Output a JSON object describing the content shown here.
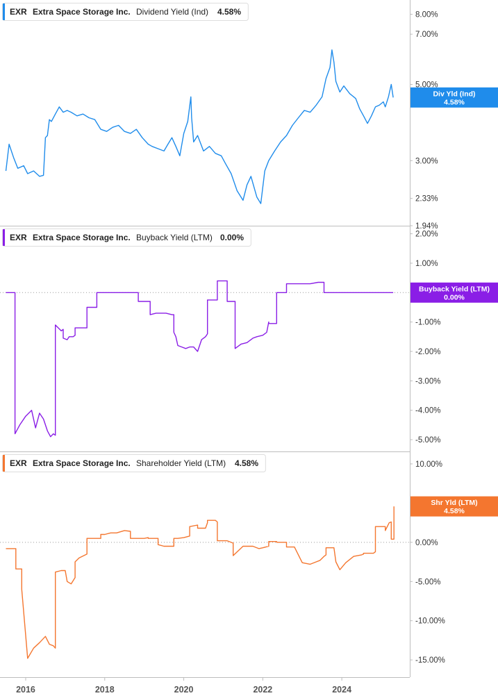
{
  "chart_data": [
    {
      "type": "line",
      "ticker": "EXR",
      "company": "Extra Space Storage Inc.",
      "metric": "Dividend Yield (Ind)",
      "latest": "4.58%",
      "tag_label": "Div Yld (Ind)",
      "tag_value": "4.58%",
      "color": "#1f8ceb",
      "scale": "log",
      "ylim": [
        1.94,
        8.8
      ],
      "y_ticks": [
        "8.00%",
        "7.00%",
        "5.00%",
        "3.00%",
        "2.33%",
        "1.94%"
      ],
      "y_tick_values": [
        8.0,
        7.0,
        5.0,
        3.0,
        2.33,
        1.94
      ],
      "zero_line": false,
      "x": [
        2015.5,
        2015.58,
        2015.7,
        2015.8,
        2015.95,
        2016.05,
        2016.2,
        2016.35,
        2016.45,
        2016.5,
        2016.55,
        2016.6,
        2016.65,
        2016.75,
        2016.85,
        2016.95,
        2017.05,
        2017.15,
        2017.3,
        2017.45,
        2017.6,
        2017.75,
        2017.9,
        2018.05,
        2018.2,
        2018.35,
        2018.5,
        2018.65,
        2018.8,
        2018.95,
        2019.1,
        2019.2,
        2019.35,
        2019.5,
        2019.6,
        2019.7,
        2019.8,
        2019.9,
        2020.0,
        2020.1,
        2020.18,
        2020.2,
        2020.25,
        2020.35,
        2020.5,
        2020.65,
        2020.8,
        2020.95,
        2021.05,
        2021.2,
        2021.35,
        2021.5,
        2021.6,
        2021.7,
        2021.85,
        2021.95,
        2022.05,
        2022.15,
        2022.3,
        2022.45,
        2022.6,
        2022.75,
        2022.9,
        2023.05,
        2023.2,
        2023.35,
        2023.5,
        2023.6,
        2023.7,
        2023.75,
        2023.8,
        2023.85,
        2023.95,
        2024.05,
        2024.2,
        2024.35,
        2024.45,
        2024.55,
        2024.65,
        2024.75,
        2024.85,
        2024.95,
        2025.05,
        2025.1,
        2025.18,
        2025.25,
        2025.3
      ],
      "values": [
        2.8,
        3.35,
        3.05,
        2.85,
        2.9,
        2.75,
        2.8,
        2.7,
        2.72,
        3.5,
        3.55,
        3.95,
        3.9,
        4.1,
        4.3,
        4.15,
        4.2,
        4.15,
        4.05,
        4.1,
        4.0,
        3.95,
        3.7,
        3.65,
        3.75,
        3.8,
        3.65,
        3.6,
        3.7,
        3.5,
        3.35,
        3.3,
        3.25,
        3.2,
        3.35,
        3.5,
        3.3,
        3.1,
        3.6,
        3.9,
        4.6,
        4.0,
        3.4,
        3.55,
        3.2,
        3.3,
        3.15,
        3.1,
        2.95,
        2.75,
        2.45,
        2.3,
        2.55,
        2.7,
        2.35,
        2.25,
        2.8,
        3.0,
        3.2,
        3.4,
        3.55,
        3.8,
        4.0,
        4.2,
        4.15,
        4.35,
        4.6,
        5.2,
        5.6,
        6.3,
        5.8,
        5.1,
        4.75,
        4.95,
        4.7,
        4.55,
        4.25,
        4.05,
        3.85,
        4.05,
        4.3,
        4.35,
        4.45,
        4.3,
        4.6,
        5.0,
        4.58
      ]
    },
    {
      "type": "line",
      "ticker": "EXR",
      "company": "Extra Space Storage Inc.",
      "metric": "Buyback Yield (LTM)",
      "latest": "0.00%",
      "tag_label": "Buyback Yield (LTM)",
      "tag_value": "0.00%",
      "color": "#8a1ee6",
      "scale": "linear",
      "ylim": [
        -5.4,
        2.25
      ],
      "y_ticks": [
        "2.00%",
        "1.00%",
        "-1.00%",
        "-2.00%",
        "-3.00%",
        "-4.00%",
        "-5.00%"
      ],
      "y_tick_values": [
        2,
        1,
        -1,
        -2,
        -3,
        -4,
        -5
      ],
      "zero_line": true,
      "x": [
        2015.5,
        2015.73,
        2015.73,
        2015.85,
        2016.0,
        2016.15,
        2016.25,
        2016.35,
        2016.45,
        2016.55,
        2016.63,
        2016.7,
        2016.75,
        2016.75,
        2016.9,
        2016.95,
        2016.95,
        2017.05,
        2017.1,
        2017.2,
        2017.25,
        2017.25,
        2017.35,
        2017.45,
        2017.55,
        2017.55,
        2017.75,
        2017.8,
        2017.8,
        2018.0,
        2018.2,
        2018.4,
        2018.65,
        2018.85,
        2018.85,
        2019.1,
        2019.15,
        2019.15,
        2019.3,
        2019.55,
        2019.7,
        2019.75,
        2019.75,
        2019.8,
        2019.85,
        2019.95,
        2020.05,
        2020.15,
        2020.25,
        2020.35,
        2020.45,
        2020.55,
        2020.6,
        2020.6,
        2020.75,
        2020.85,
        2020.85,
        2021.1,
        2021.1,
        2021.3,
        2021.3,
        2021.45,
        2021.6,
        2021.75,
        2021.85,
        2022.0,
        2022.1,
        2022.15,
        2022.15,
        2022.3,
        2022.35,
        2022.35,
        2022.55,
        2022.6,
        2022.6,
        2022.8,
        2023.0,
        2023.2,
        2023.4,
        2023.55,
        2023.55,
        2024.0,
        2024.5,
        2025.0,
        2025.3
      ],
      "values": [
        0.0,
        0.0,
        -4.8,
        -4.5,
        -4.2,
        -4.0,
        -4.6,
        -4.1,
        -4.3,
        -4.7,
        -4.9,
        -4.8,
        -4.85,
        -1.1,
        -1.3,
        -1.25,
        -1.55,
        -1.6,
        -1.5,
        -1.5,
        -1.45,
        -1.2,
        -1.2,
        -1.2,
        -1.2,
        -0.5,
        -0.5,
        -0.5,
        0.0,
        0.0,
        0.0,
        0.0,
        0.0,
        0.0,
        -0.3,
        -0.3,
        -0.3,
        -0.75,
        -0.7,
        -0.7,
        -0.75,
        -0.75,
        -1.35,
        -1.5,
        -1.8,
        -1.85,
        -1.9,
        -1.85,
        -1.85,
        -2.0,
        -1.6,
        -1.5,
        -1.4,
        -0.25,
        -0.25,
        -0.25,
        0.4,
        0.4,
        -0.3,
        -0.3,
        -1.9,
        -1.75,
        -1.7,
        -1.55,
        -1.5,
        -1.45,
        -1.35,
        -1.0,
        -1.05,
        -1.05,
        -1.05,
        0.0,
        0.0,
        0.0,
        0.3,
        0.3,
        0.3,
        0.3,
        0.35,
        0.35,
        0.0,
        0.0,
        0.0,
        0.0,
        0.0
      ]
    },
    {
      "type": "line",
      "ticker": "EXR",
      "company": "Extra Space Storage Inc.",
      "metric": "Shareholder Yield (LTM)",
      "latest": "4.58%",
      "tag_label": "Shr Yld (LTM)",
      "tag_value": "4.58%",
      "color": "#f4762f",
      "scale": "linear",
      "ylim": [
        -17.2,
        11.5
      ],
      "y_ticks": [
        "10.00%",
        "5.00%",
        "0.00%",
        "-5.00%",
        "-10.00%",
        "-15.00%"
      ],
      "y_tick_values": [
        10,
        5,
        0,
        -5,
        -10,
        -15
      ],
      "zero_line": true,
      "x": [
        2015.5,
        2015.75,
        2015.75,
        2015.9,
        2015.9,
        2016.05,
        2016.2,
        2016.35,
        2016.5,
        2016.6,
        2016.7,
        2016.75,
        2016.75,
        2016.9,
        2017.0,
        2017.05,
        2017.15,
        2017.25,
        2017.25,
        2017.35,
        2017.55,
        2017.55,
        2017.75,
        2017.9,
        2017.9,
        2018.0,
        2018.15,
        2018.3,
        2018.5,
        2018.65,
        2018.65,
        2019.0,
        2019.1,
        2019.1,
        2019.35,
        2019.35,
        2019.5,
        2019.75,
        2019.75,
        2019.85,
        2020.0,
        2020.15,
        2020.15,
        2020.35,
        2020.35,
        2020.55,
        2020.6,
        2020.6,
        2020.8,
        2020.85,
        2020.85,
        2021.1,
        2021.1,
        2021.25,
        2021.25,
        2021.5,
        2021.75,
        2021.9,
        2022.0,
        2022.15,
        2022.15,
        2022.3,
        2022.35,
        2022.35,
        2022.55,
        2022.6,
        2022.6,
        2022.8,
        2023.0,
        2023.2,
        2023.35,
        2023.45,
        2023.55,
        2023.6,
        2023.6,
        2023.8,
        2023.85,
        2023.95,
        2024.1,
        2024.3,
        2024.5,
        2024.55,
        2024.55,
        2024.8,
        2024.85,
        2024.85,
        2025.05,
        2025.1,
        2025.1,
        2025.2,
        2025.25,
        2025.25,
        2025.32,
        2025.32
      ],
      "values": [
        -0.8,
        -0.8,
        -3.4,
        -3.4,
        -6.0,
        -14.8,
        -13.5,
        -12.8,
        -12.0,
        -13.0,
        -13.2,
        -13.5,
        -3.8,
        -3.6,
        -3.6,
        -5.0,
        -5.3,
        -4.5,
        -2.5,
        -2.0,
        -1.5,
        0.5,
        0.5,
        0.5,
        1.0,
        1.0,
        1.2,
        1.2,
        1.5,
        1.4,
        0.5,
        0.5,
        0.6,
        0.5,
        0.5,
        -0.3,
        -0.5,
        -0.5,
        0.5,
        0.5,
        0.6,
        0.8,
        2.0,
        2.2,
        1.8,
        1.8,
        2.5,
        2.8,
        2.8,
        2.6,
        0.2,
        0.2,
        0.2,
        -0.1,
        -1.7,
        -0.5,
        -0.5,
        -0.8,
        -0.7,
        -0.5,
        0.1,
        0.1,
        0.1,
        0.0,
        0.0,
        0.0,
        -0.6,
        -0.6,
        -2.6,
        -2.8,
        -2.5,
        -2.3,
        -1.8,
        -1.6,
        -0.7,
        -0.7,
        -2.5,
        -3.5,
        -2.6,
        -1.8,
        -1.6,
        -1.5,
        -1.4,
        -1.4,
        -1.2,
        2.0,
        2.0,
        2.0,
        1.5,
        2.5,
        2.6,
        0.4,
        0.4,
        4.58
      ]
    }
  ],
  "x_axis": {
    "ticks": [
      "2016",
      "2018",
      "2020",
      "2022",
      "2024"
    ],
    "tick_values": [
      2016,
      2018,
      2020,
      2022,
      2024
    ],
    "xlim": [
      2015.35,
      2025.72
    ]
  }
}
